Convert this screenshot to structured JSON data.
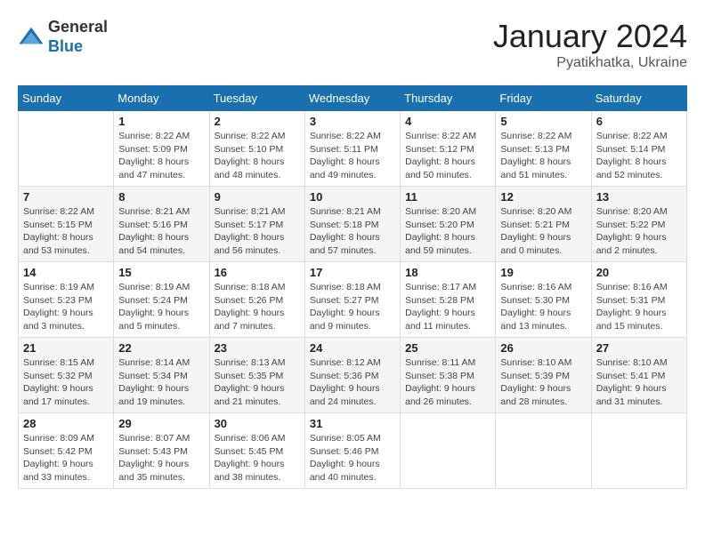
{
  "logo": {
    "general": "General",
    "blue": "Blue"
  },
  "title": "January 2024",
  "location": "Pyatikhatka, Ukraine",
  "days_of_week": [
    "Sunday",
    "Monday",
    "Tuesday",
    "Wednesday",
    "Thursday",
    "Friday",
    "Saturday"
  ],
  "weeks": [
    [
      {
        "day": "",
        "info": ""
      },
      {
        "day": "1",
        "info": "Sunrise: 8:22 AM\nSunset: 5:09 PM\nDaylight: 8 hours\nand 47 minutes."
      },
      {
        "day": "2",
        "info": "Sunrise: 8:22 AM\nSunset: 5:10 PM\nDaylight: 8 hours\nand 48 minutes."
      },
      {
        "day": "3",
        "info": "Sunrise: 8:22 AM\nSunset: 5:11 PM\nDaylight: 8 hours\nand 49 minutes."
      },
      {
        "day": "4",
        "info": "Sunrise: 8:22 AM\nSunset: 5:12 PM\nDaylight: 8 hours\nand 50 minutes."
      },
      {
        "day": "5",
        "info": "Sunrise: 8:22 AM\nSunset: 5:13 PM\nDaylight: 8 hours\nand 51 minutes."
      },
      {
        "day": "6",
        "info": "Sunrise: 8:22 AM\nSunset: 5:14 PM\nDaylight: 8 hours\nand 52 minutes."
      }
    ],
    [
      {
        "day": "7",
        "info": "Sunrise: 8:22 AM\nSunset: 5:15 PM\nDaylight: 8 hours\nand 53 minutes."
      },
      {
        "day": "8",
        "info": "Sunrise: 8:21 AM\nSunset: 5:16 PM\nDaylight: 8 hours\nand 54 minutes."
      },
      {
        "day": "9",
        "info": "Sunrise: 8:21 AM\nSunset: 5:17 PM\nDaylight: 8 hours\nand 56 minutes."
      },
      {
        "day": "10",
        "info": "Sunrise: 8:21 AM\nSunset: 5:18 PM\nDaylight: 8 hours\nand 57 minutes."
      },
      {
        "day": "11",
        "info": "Sunrise: 8:20 AM\nSunset: 5:20 PM\nDaylight: 8 hours\nand 59 minutes."
      },
      {
        "day": "12",
        "info": "Sunrise: 8:20 AM\nSunset: 5:21 PM\nDaylight: 9 hours\nand 0 minutes."
      },
      {
        "day": "13",
        "info": "Sunrise: 8:20 AM\nSunset: 5:22 PM\nDaylight: 9 hours\nand 2 minutes."
      }
    ],
    [
      {
        "day": "14",
        "info": "Sunrise: 8:19 AM\nSunset: 5:23 PM\nDaylight: 9 hours\nand 3 minutes."
      },
      {
        "day": "15",
        "info": "Sunrise: 8:19 AM\nSunset: 5:24 PM\nDaylight: 9 hours\nand 5 minutes."
      },
      {
        "day": "16",
        "info": "Sunrise: 8:18 AM\nSunset: 5:26 PM\nDaylight: 9 hours\nand 7 minutes."
      },
      {
        "day": "17",
        "info": "Sunrise: 8:18 AM\nSunset: 5:27 PM\nDaylight: 9 hours\nand 9 minutes."
      },
      {
        "day": "18",
        "info": "Sunrise: 8:17 AM\nSunset: 5:28 PM\nDaylight: 9 hours\nand 11 minutes."
      },
      {
        "day": "19",
        "info": "Sunrise: 8:16 AM\nSunset: 5:30 PM\nDaylight: 9 hours\nand 13 minutes."
      },
      {
        "day": "20",
        "info": "Sunrise: 8:16 AM\nSunset: 5:31 PM\nDaylight: 9 hours\nand 15 minutes."
      }
    ],
    [
      {
        "day": "21",
        "info": "Sunrise: 8:15 AM\nSunset: 5:32 PM\nDaylight: 9 hours\nand 17 minutes."
      },
      {
        "day": "22",
        "info": "Sunrise: 8:14 AM\nSunset: 5:34 PM\nDaylight: 9 hours\nand 19 minutes."
      },
      {
        "day": "23",
        "info": "Sunrise: 8:13 AM\nSunset: 5:35 PM\nDaylight: 9 hours\nand 21 minutes."
      },
      {
        "day": "24",
        "info": "Sunrise: 8:12 AM\nSunset: 5:36 PM\nDaylight: 9 hours\nand 24 minutes."
      },
      {
        "day": "25",
        "info": "Sunrise: 8:11 AM\nSunset: 5:38 PM\nDaylight: 9 hours\nand 26 minutes."
      },
      {
        "day": "26",
        "info": "Sunrise: 8:10 AM\nSunset: 5:39 PM\nDaylight: 9 hours\nand 28 minutes."
      },
      {
        "day": "27",
        "info": "Sunrise: 8:10 AM\nSunset: 5:41 PM\nDaylight: 9 hours\nand 31 minutes."
      }
    ],
    [
      {
        "day": "28",
        "info": "Sunrise: 8:09 AM\nSunset: 5:42 PM\nDaylight: 9 hours\nand 33 minutes."
      },
      {
        "day": "29",
        "info": "Sunrise: 8:07 AM\nSunset: 5:43 PM\nDaylight: 9 hours\nand 35 minutes."
      },
      {
        "day": "30",
        "info": "Sunrise: 8:06 AM\nSunset: 5:45 PM\nDaylight: 9 hours\nand 38 minutes."
      },
      {
        "day": "31",
        "info": "Sunrise: 8:05 AM\nSunset: 5:46 PM\nDaylight: 9 hours\nand 40 minutes."
      },
      {
        "day": "",
        "info": ""
      },
      {
        "day": "",
        "info": ""
      },
      {
        "day": "",
        "info": ""
      }
    ]
  ]
}
